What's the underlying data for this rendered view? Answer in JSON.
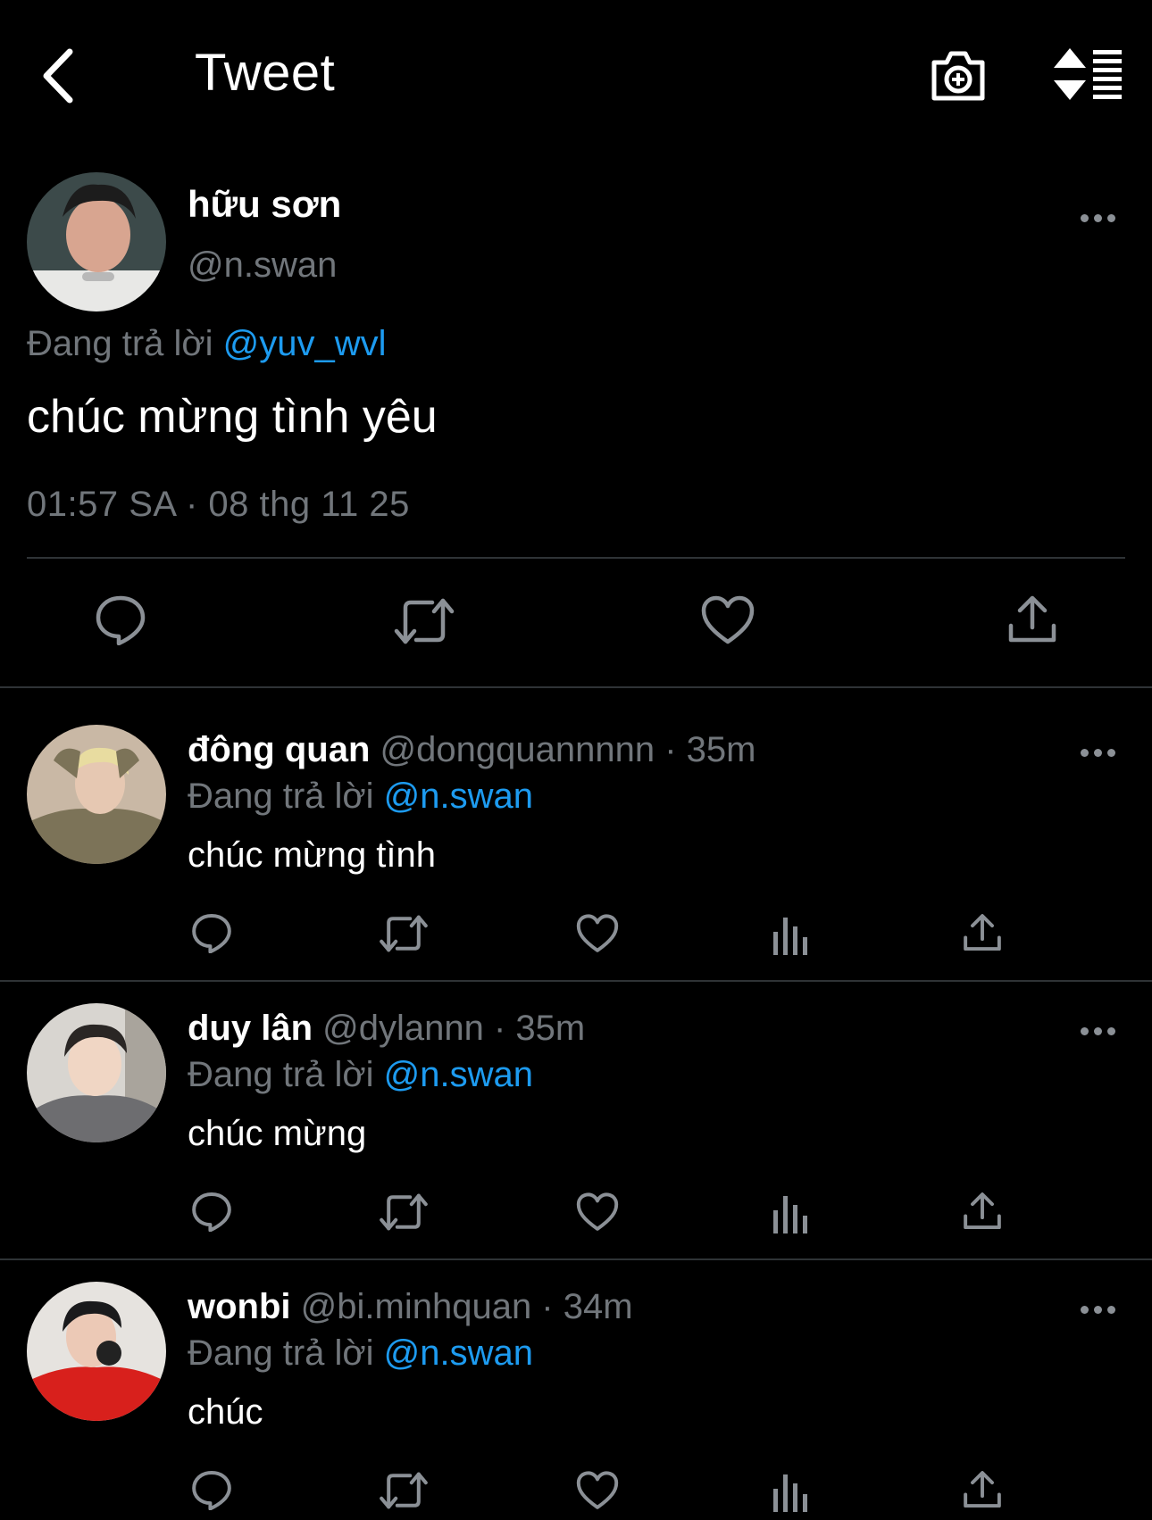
{
  "header": {
    "title": "Tweet",
    "back_icon": "chevron-left-icon",
    "camera_icon": "camera-plus-icon",
    "sort_icon": "sort-list-icon"
  },
  "main_tweet": {
    "name": "hữu sơn",
    "handle": "@n.swan",
    "reply_prefix": "Đang trả lời",
    "reply_to": "@yuv_wvl",
    "text": "chúc mừng tình yêu",
    "timestamp": "01:57 SA · 08 thg 11 25",
    "actions": [
      "reply-icon",
      "retweet-icon",
      "like-icon",
      "share-icon"
    ]
  },
  "replies": [
    {
      "name": "đông quan",
      "meta": "@dongquannnnn · 35m",
      "reply_prefix": "Đang trả lời",
      "reply_to": "@n.swan",
      "text": "chúc mừng tình"
    },
    {
      "name": "duy lân",
      "meta": "@dylannn · 35m",
      "reply_prefix": "Đang trả lời",
      "reply_to": "@n.swan",
      "text": "chúc mừng"
    },
    {
      "name": "wonbi",
      "meta": "@bi.minhquan · 34m",
      "reply_prefix": "Đang trả lời",
      "reply_to": "@n.swan",
      "text": "chúc"
    }
  ],
  "colors": {
    "background": "#000000",
    "text": "#e7e9ea",
    "muted": "#71767b",
    "accent": "#1d9bf0",
    "divider": "#2f3336"
  }
}
